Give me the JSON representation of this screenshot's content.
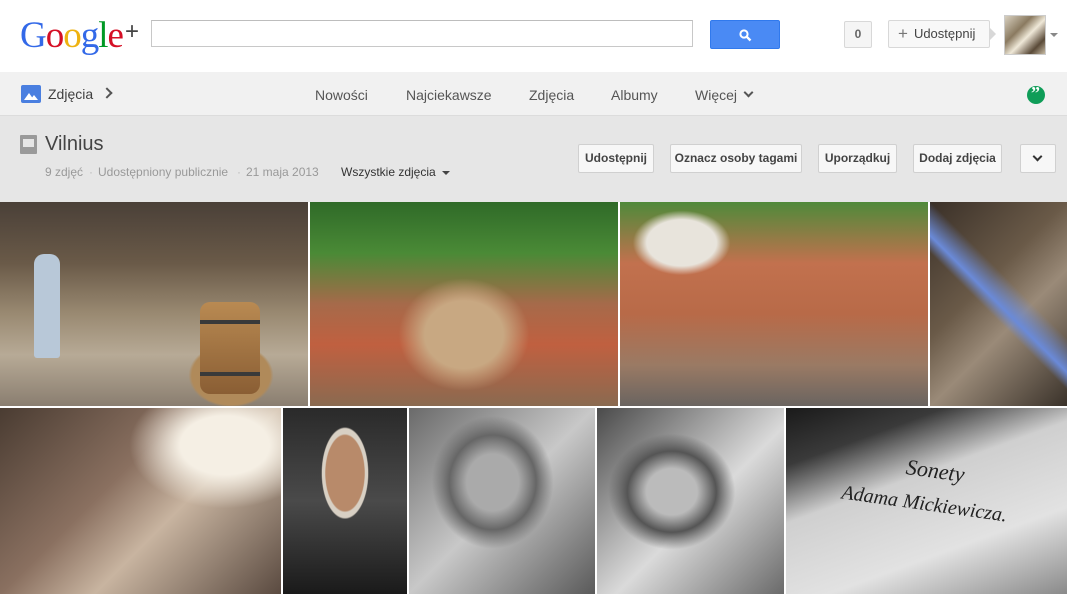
{
  "header": {
    "logo_letters": [
      "G",
      "o",
      "o",
      "g",
      "l",
      "e"
    ],
    "logo_plus": "+",
    "search": {
      "placeholder": ""
    },
    "notifications_count": "0",
    "share_label": "Udostępnij"
  },
  "nav": {
    "section_title": "Zdjęcia",
    "links": [
      "Nowości",
      "Najciekawsze",
      "Zdjęcia",
      "Albumy",
      "Więcej"
    ]
  },
  "album": {
    "title": "Vilnius",
    "photo_count": "9 zdjęć",
    "visibility": "Udostępniony publicznie",
    "date": "21 maja 2013",
    "filter_label": "Wszystkie zdjęcia",
    "buttons": [
      "Udostępnij",
      "Oznacz osoby tagami",
      "Uporządkuj",
      "Dodaj zdjęcia"
    ]
  },
  "photos": [
    {
      "name": "street-cafe-photo"
    },
    {
      "name": "rooftops-church-photo"
    },
    {
      "name": "old-town-rooftops-photo"
    },
    {
      "name": "tower-interior-photo"
    },
    {
      "name": "wooden-beams-photo"
    },
    {
      "name": "arched-window-photo"
    },
    {
      "name": "skull-sculpture-photo"
    },
    {
      "name": "skull-sculpture-2-photo"
    },
    {
      "name": "sonety-book-photo",
      "text_line1": "Sonety",
      "text_line2": "Adama Mickiewicza."
    }
  ],
  "colors": {
    "logo": [
      "#3369e8",
      "#d50f25",
      "#eeb211",
      "#3369e8",
      "#009925",
      "#d50f25"
    ],
    "search_button": "#4a8af4",
    "hangouts": "#0f9d58"
  }
}
